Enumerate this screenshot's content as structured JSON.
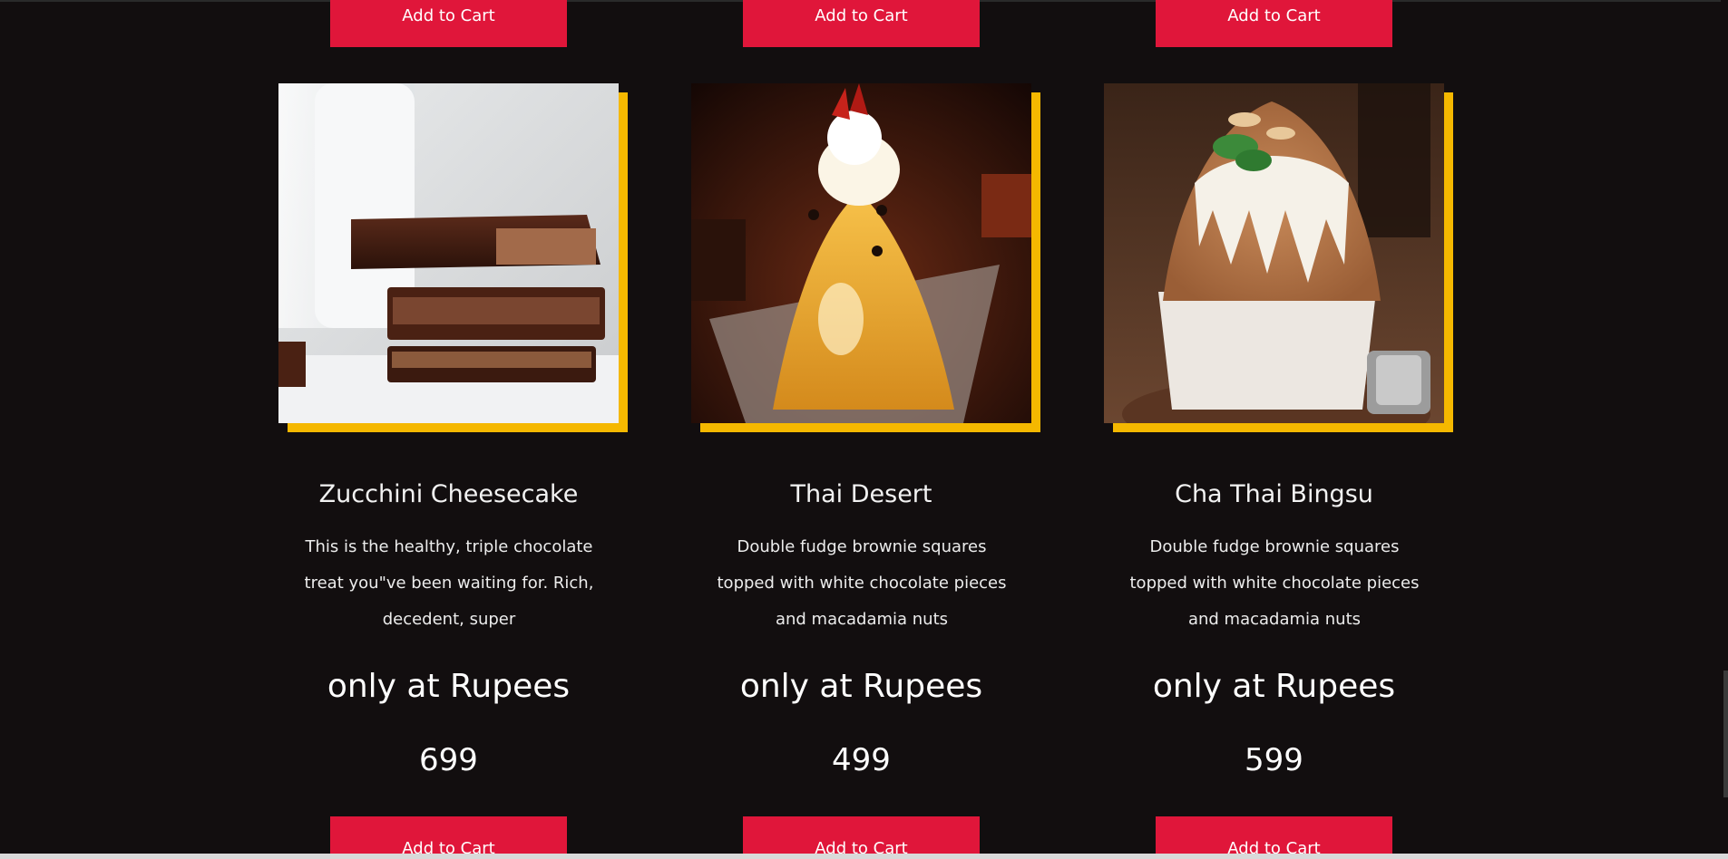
{
  "top_buttons": [
    "Add to Cart",
    "Add to Cart",
    "Add to Cart"
  ],
  "products": [
    {
      "title": "Zucchini Cheesecake",
      "description": "This is the healthy, triple chocolate treat you\"ve been waiting for. Rich, decedent, super",
      "price_label": "only at Rupees",
      "price": "699",
      "button": "Add to Cart",
      "image": "chocolate-bars-image"
    },
    {
      "title": "Thai Desert",
      "description": "Double fudge brownie squares topped with white chocolate pieces and macadamia nuts",
      "price_label": "only at Rupees",
      "price": "499",
      "button": "Add to Cart",
      "image": "thai-dessert-image"
    },
    {
      "title": "Cha Thai Bingsu",
      "description": "Double fudge brownie squares topped with white chocolate pieces and macadamia nuts",
      "price_label": "only at Rupees",
      "price": "599",
      "button": "Add to Cart",
      "image": "bingsu-image"
    }
  ],
  "colors": {
    "background": "#120e0f",
    "button": "#e0163a",
    "accent_shadow": "#f5b800"
  }
}
